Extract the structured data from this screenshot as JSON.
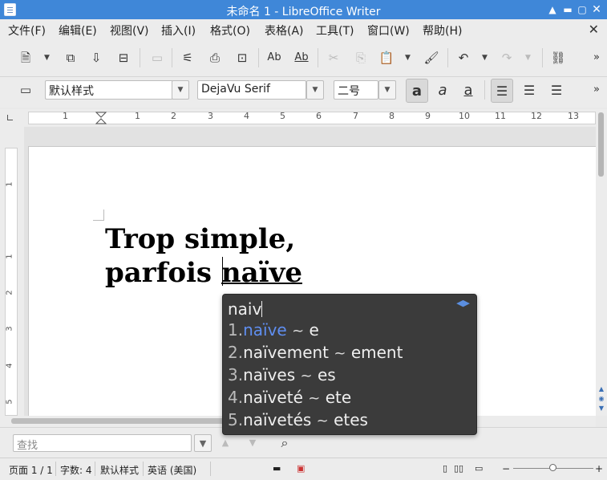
{
  "window": {
    "title": "未命名 1 - LibreOffice Writer"
  },
  "menu": [
    {
      "label": "文件(F)"
    },
    {
      "label": "编辑(E)"
    },
    {
      "label": "视图(V)"
    },
    {
      "label": "插入(I)"
    },
    {
      "label": "格式(O)"
    },
    {
      "label": "表格(A)"
    },
    {
      "label": "工具(T)"
    },
    {
      "label": "窗口(W)"
    },
    {
      "label": "帮助(H)"
    }
  ],
  "formatting": {
    "paragraph_style": "默认样式",
    "font_name": "DejaVu Serif",
    "font_size": "二号"
  },
  "ruler": {
    "h_numbers": [
      "1",
      "1",
      "2",
      "3",
      "4",
      "5",
      "6",
      "7",
      "8",
      "9",
      "10",
      "11",
      "12",
      "13"
    ],
    "v_numbers": [
      "1",
      "1",
      "2",
      "3",
      "4",
      "5"
    ]
  },
  "document": {
    "line1": "Trop simple,",
    "line2_prefix": "parfois ",
    "line2_word": "naïve"
  },
  "ime": {
    "input": "naiv",
    "candidates": [
      {
        "index": "1.",
        "word": "naïve",
        "sep": "~",
        "suffix": "e"
      },
      {
        "index": "2.",
        "word": "naïvement",
        "sep": "~",
        "suffix": "ement"
      },
      {
        "index": "3.",
        "word": "naïves",
        "sep": "~",
        "suffix": "es"
      },
      {
        "index": "4.",
        "word": "naïveté",
        "sep": "~",
        "suffix": "ete"
      },
      {
        "index": "5.",
        "word": "naïvetés",
        "sep": "~",
        "suffix": "etes"
      }
    ],
    "selected_index": 0,
    "accent_color": "#5f8ef0"
  },
  "find": {
    "placeholder": "查找"
  },
  "status": {
    "page": "页面 1 / 1",
    "words": "字数: 4",
    "style": "默认样式",
    "language": "英语 (美国)"
  },
  "colors": {
    "titlebar": "#3f87d8"
  }
}
